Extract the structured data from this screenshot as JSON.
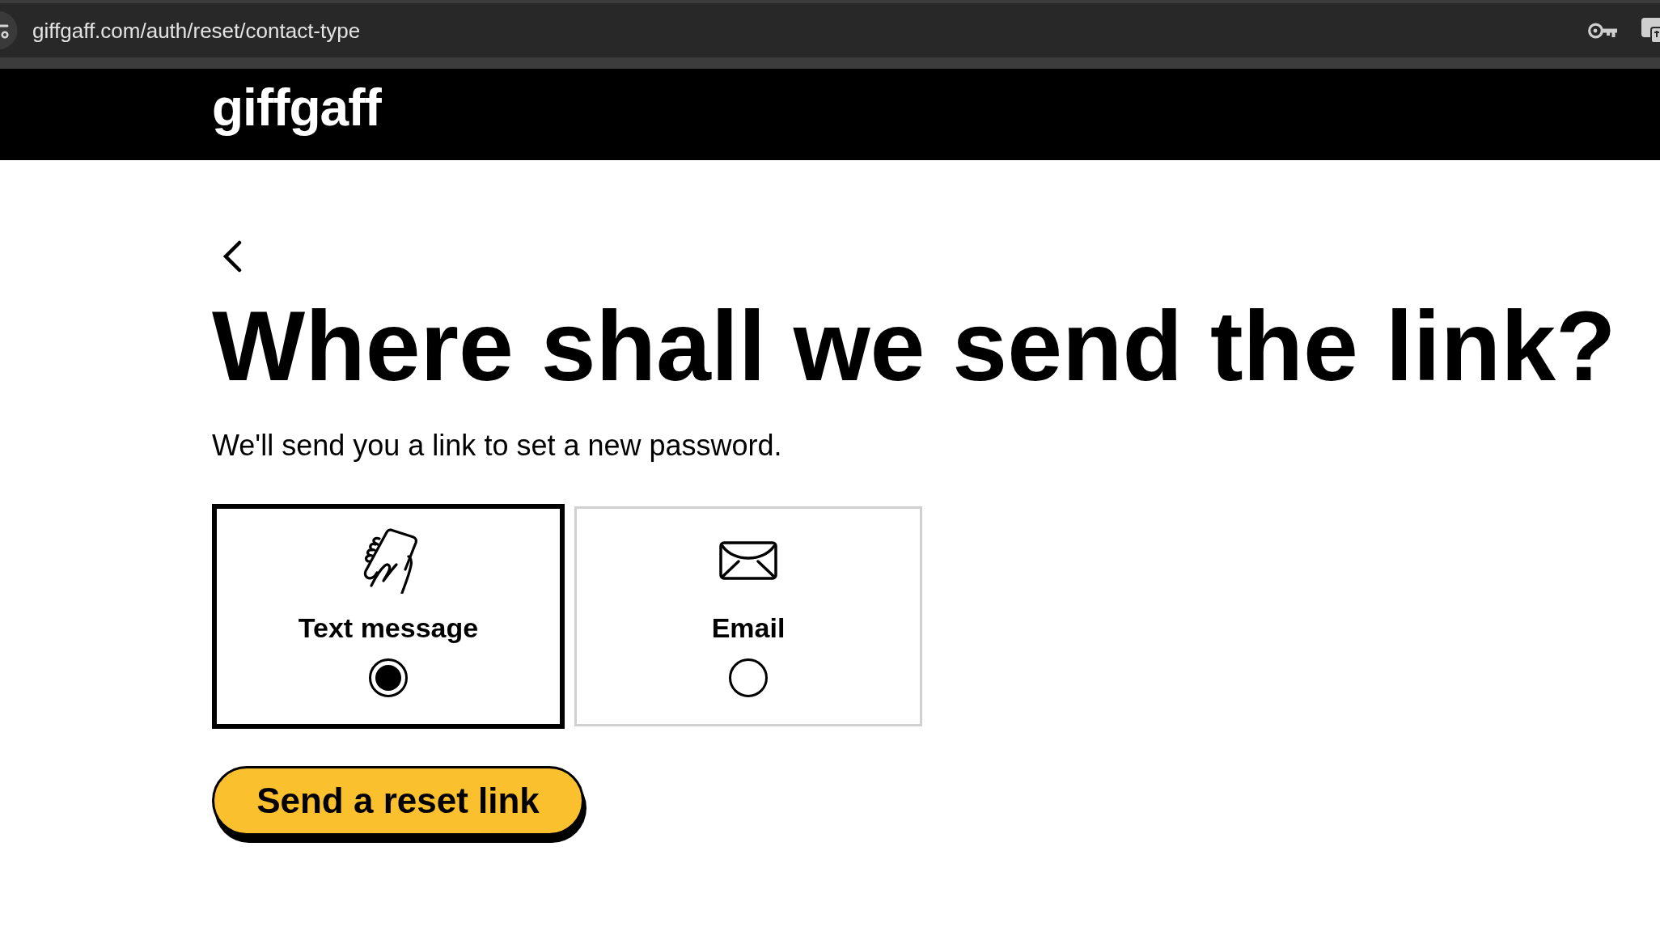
{
  "browser": {
    "url": "giffgaff.com/auth/reset/contact-type"
  },
  "header": {
    "logo": "giffgaff"
  },
  "page": {
    "title": "Where shall we send the link?",
    "subtitle": "We'll send you a link to set a new password.",
    "options": [
      {
        "kind": "sms",
        "label": "Text message",
        "selected": true
      },
      {
        "kind": "email",
        "label": "Email",
        "selected": false
      }
    ],
    "submit_button": "Send a reset link"
  }
}
